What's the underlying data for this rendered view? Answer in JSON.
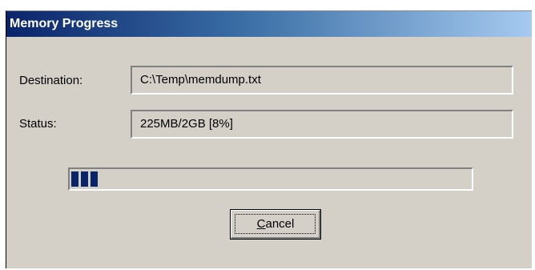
{
  "window": {
    "title": "Memory Progress"
  },
  "form": {
    "destination_label": "Destination:",
    "destination_value": "C:\\Temp\\memdump.txt",
    "status_label": "Status:",
    "status_value": "225MB/2GB [8%]"
  },
  "progress": {
    "percent": 8
  },
  "buttons": {
    "cancel_label_mnemonic": "C",
    "cancel_label_rest": "ancel"
  },
  "colors": {
    "titlebar_start": "#0a246a",
    "titlebar_end": "#a6caf0",
    "progress_fill": "#0a246a",
    "dialog_face": "#d4d0c8"
  }
}
